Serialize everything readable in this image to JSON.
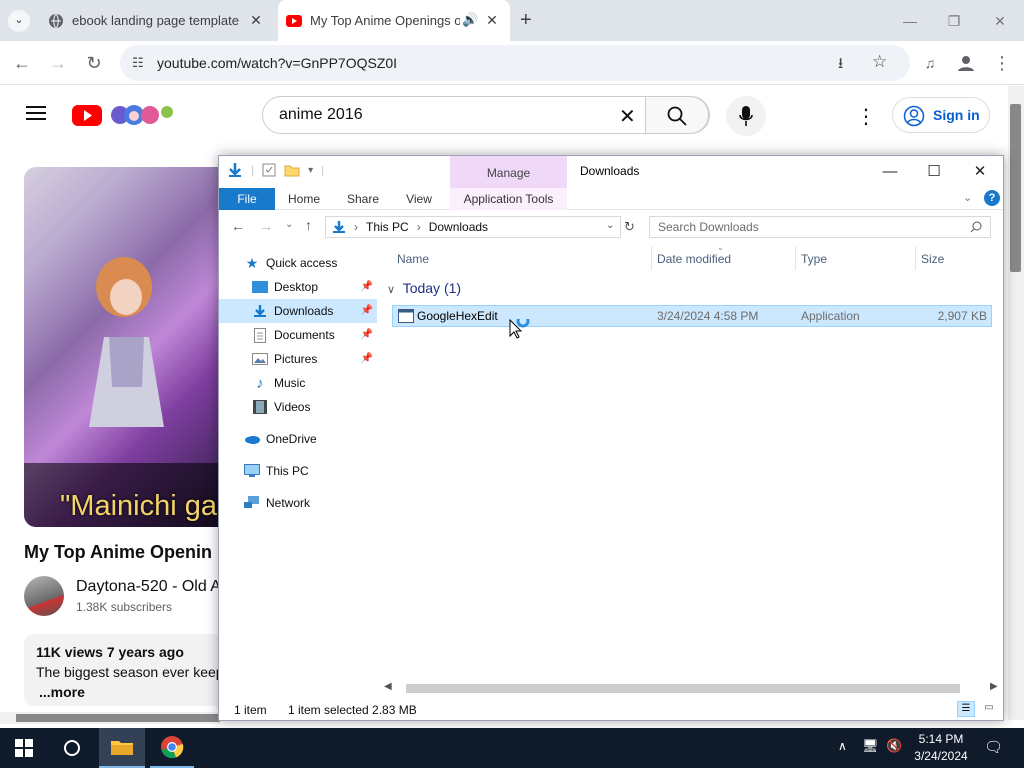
{
  "chrome": {
    "tabs": [
      {
        "title": "ebook landing page template"
      },
      {
        "title": "My Top Anime Openings of"
      }
    ],
    "url": "youtube.com/watch?v=GnPP7OQSZ0I"
  },
  "youtube": {
    "search_query": "anime 2016",
    "sign_in": "Sign in",
    "video_lyric": "\"Mainichi ga",
    "video_title": "My Top Anime Openin",
    "channel_name": "Daytona-520 - Old A",
    "subscribers": "1.38K subscribers",
    "views": "11K views  7 years ago",
    "description": "The biggest season ever keep",
    "more": "...more"
  },
  "explorer": {
    "window_title": "Downloads",
    "manage_tab": "Manage",
    "ribbon_tabs": [
      "File",
      "Home",
      "Share",
      "View",
      "Application Tools"
    ],
    "breadcrumb": [
      "This PC",
      "Downloads"
    ],
    "search_placeholder": "Search Downloads",
    "nav": {
      "quick_access": "Quick access",
      "desktop": "Desktop",
      "downloads": "Downloads",
      "documents": "Documents",
      "pictures": "Pictures",
      "music": "Music",
      "videos": "Videos",
      "onedrive": "OneDrive",
      "this_pc": "This PC",
      "network": "Network"
    },
    "columns": {
      "name": "Name",
      "date": "Date modified",
      "type": "Type",
      "size": "Size"
    },
    "group_label": "Today (1)",
    "file": {
      "name": "GoogleHexEdit",
      "date": "3/24/2024 4:58 PM",
      "type": "Application",
      "size": "2,907 KB"
    },
    "status": {
      "count": "1 item",
      "selected": "1 item selected  2.83 MB"
    }
  },
  "taskbar": {
    "time": "5:14 PM",
    "date": "3/24/2024"
  }
}
